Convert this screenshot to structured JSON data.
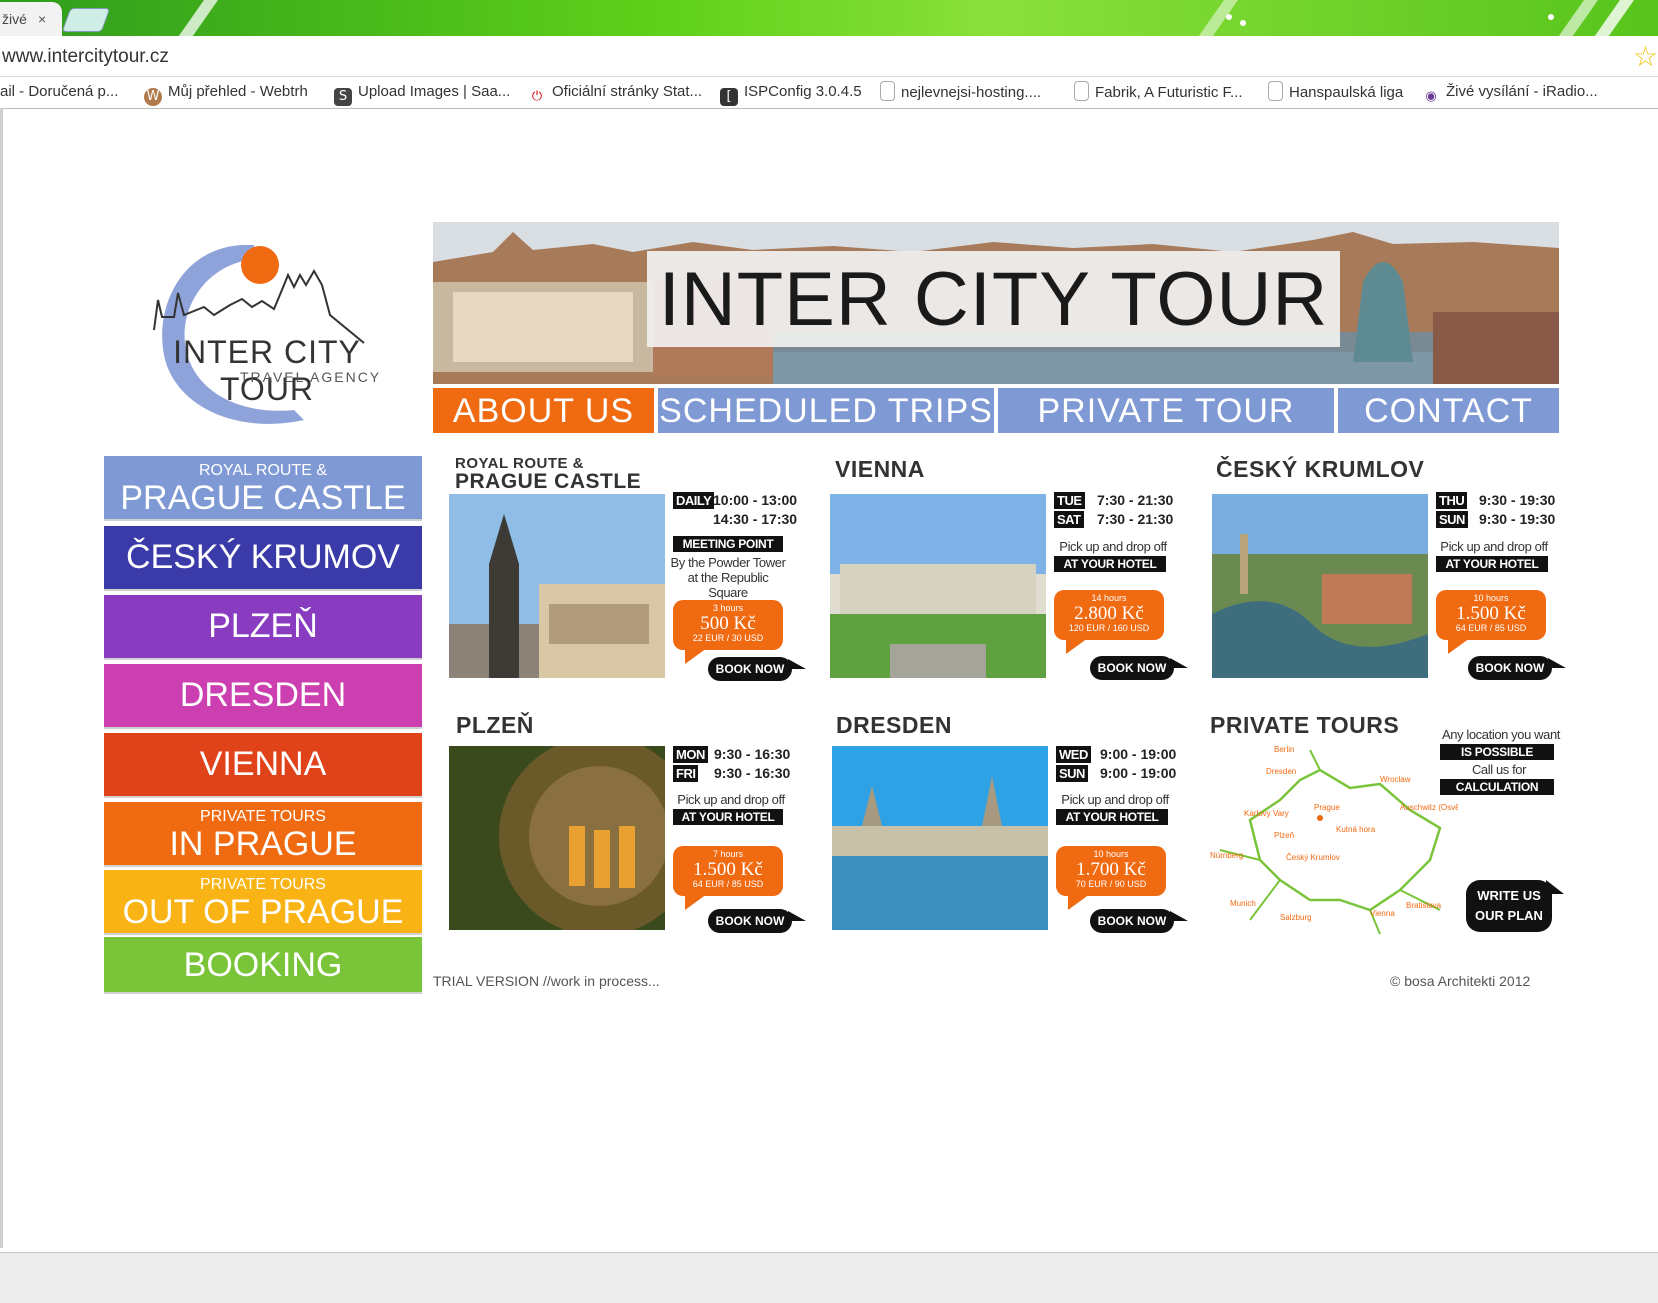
{
  "browser": {
    "tab_title": "živé",
    "tab_close": "×",
    "url": "www.intercitytour.cz",
    "bookmarks": [
      {
        "label": "ail - Doručená p...",
        "icon": "mail-icon"
      },
      {
        "label": "Můj přehled - Webtrh",
        "icon": "webtrh-icon"
      },
      {
        "label": "Upload Images | Saa...",
        "icon": "upload-icon"
      },
      {
        "label": "Oficiální stránky Stat...",
        "icon": "official-icon"
      },
      {
        "label": "ISPConfig 3.0.4.5",
        "icon": "ispconfig-icon"
      },
      {
        "label": "nejlevnejsi-hosting....",
        "icon": "page-icon"
      },
      {
        "label": "Fabrik, A Futuristic F...",
        "icon": "page-icon"
      },
      {
        "label": "Hanspaulská liga",
        "icon": "page-icon"
      },
      {
        "label": "Živé vysílání - iRadio...",
        "icon": "radio-icon"
      }
    ]
  },
  "logo": {
    "title": "INTER CITY TOUR",
    "subtitle": "TRAVEL AGENCY"
  },
  "banner": {
    "title": "INTER CITY TOUR"
  },
  "topnav": {
    "about": "ABOUT US",
    "scheduled": "SCHEDULED TRIPS",
    "private": "PRIVATE TOUR",
    "contact": "CONTACT",
    "colors": {
      "about": "#f06a12",
      "others": "#7f99d4"
    }
  },
  "sidenav": {
    "prague_castle": {
      "small": "ROYAL ROUTE &",
      "big": "PRAGUE CASTLE",
      "color": "#7f99d4"
    },
    "cesky": {
      "label": "ČESKÝ KRUMOV",
      "color": "#3a3aa8"
    },
    "plzen": {
      "label": "PLZEŇ",
      "color": "#8a3cc0"
    },
    "dresden": {
      "label": "DRESDEN",
      "color": "#cc3fb0"
    },
    "vienna": {
      "label": "VIENNA",
      "color": "#e0431a"
    },
    "private_in": {
      "small": "PRIVATE TOURS",
      "big": "IN PRAGUE",
      "color": "#f06a12"
    },
    "private_out": {
      "small": "PRIVATE TOURS",
      "big": "OUT OF PRAGUE",
      "color": "#f9b315"
    },
    "booking": {
      "label": "BOOKING",
      "color": "#7ac43a"
    }
  },
  "trips": {
    "prague": {
      "title_pre": "ROYAL ROUTE &",
      "title": "PRAGUE CASTLE",
      "day1": "DAILY",
      "time1": "10:00 - 13:00",
      "time2": "14:30 - 17:30",
      "tag": "MEETING POINT",
      "info1": "By the Powder Tower",
      "info2": "at the Republic Square",
      "dur": "3 hours",
      "price": "500 Kč",
      "cur": "22 EUR / 30 USD",
      "book": "BOOK NOW"
    },
    "vienna": {
      "title": "VIENNA",
      "day1": "TUE",
      "time1": "7:30 - 21:30",
      "day2": "SAT",
      "time2": "7:30 - 21:30",
      "info1": "Pick up and drop off",
      "tag": "AT YOUR HOTEL",
      "dur": "14 hours",
      "price": "2.800 Kč",
      "cur": "120 EUR / 160 USD",
      "book": "BOOK NOW"
    },
    "cesky": {
      "title": "ČESKÝ KRUMLOV",
      "day1": "THU",
      "time1": "9:30 - 19:30",
      "day2": "SUN",
      "time2": "9:30 - 19:30",
      "info1": "Pick up and drop off",
      "tag": "AT YOUR HOTEL",
      "dur": "10 hours",
      "price": "1.500 Kč",
      "cur": "64 EUR / 85 USD",
      "book": "BOOK NOW"
    },
    "plzen": {
      "title": "PLZEŇ",
      "day1": "MON",
      "time1": "9:30 - 16:30",
      "day2": "FRI",
      "time2": "9:30 - 16:30",
      "info1": "Pick up and drop off",
      "tag": "AT YOUR HOTEL",
      "dur": "7 hours",
      "price": "1.500 Kč",
      "cur": "64 EUR / 85 USD",
      "book": "BOOK NOW"
    },
    "dresden": {
      "title": "DRESDEN",
      "day1": "WED",
      "time1": "9:00 - 19:00",
      "day2": "SUN",
      "time2": "9:00 - 19:00",
      "info1": "Pick up and drop off",
      "tag": "AT YOUR HOTEL",
      "dur": "10 hours",
      "price": "1.700 Kč",
      "cur": "70 EUR / 90 USD",
      "book": "BOOK NOW"
    },
    "private": {
      "title": "PRIVATE TOURS",
      "info1": "Any location you want",
      "tag1": "IS POSSIBLE",
      "info2": "Call us for",
      "tag2": "CALCULATION",
      "write1": "WRITE US",
      "write2": "OUR PLAN",
      "cities": [
        "Berlin",
        "Dresden",
        "Wroclaw",
        "Prague",
        "Karlovy Vary",
        "Kutná hora",
        "Plzeň",
        "Auschwitz (Osvětim)",
        "Nürnberg",
        "Český Krumlov",
        "Munich",
        "Salzburg",
        "Vienna",
        "Bratislava"
      ]
    }
  },
  "footer": {
    "left": "TRIAL VERSION //work in process...",
    "right": "© bosa Architekti 2012"
  }
}
